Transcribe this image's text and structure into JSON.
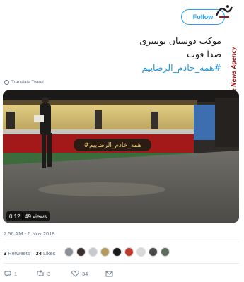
{
  "header": {
    "follow_label": "Follow"
  },
  "watermark": {
    "side_text": "Mizan Online News Agency"
  },
  "tweet": {
    "lines": [
      "موکب دوستان توییتری",
      "صدا قوت"
    ],
    "hashtag": "#همه_خادم_الرضاییم",
    "translate_label": "Translate Tweet"
  },
  "video": {
    "duration": "0:12",
    "views": "49 views",
    "banner_text": "#همه_خادم_الرضاییم"
  },
  "meta": {
    "timestamp": "7:56 AM - 6 Nov 2018"
  },
  "stats": {
    "retweets_count": "3",
    "retweets_label": "Retweets",
    "likes_count": "34",
    "likes_label": "Likes"
  },
  "avatars": [
    "#8a8f98",
    "#3b2f2f",
    "#c7c9cc",
    "#b59a5a",
    "#1a1a1a",
    "#c0392b",
    "#d9d9d9",
    "#4a4a4a",
    "#5d6d5d"
  ],
  "actions": {
    "reply_count": "1",
    "retweet_count": "3",
    "like_count": "34"
  },
  "colors": {
    "accent": "#1da1f2",
    "banner_red": "#a31818",
    "banner_green": "#3e6b3c"
  }
}
